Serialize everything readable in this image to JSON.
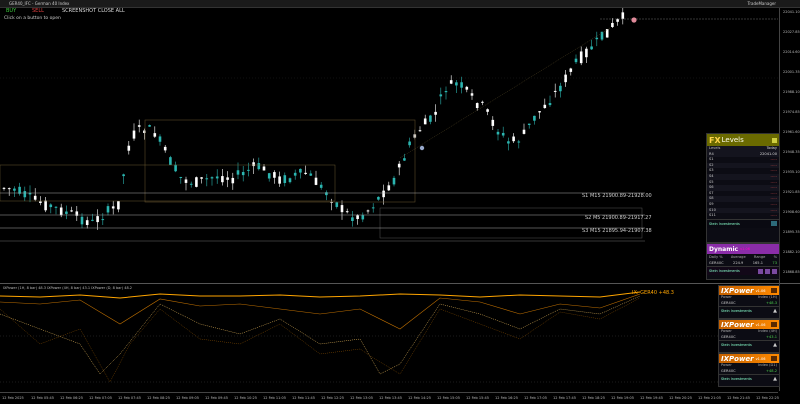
{
  "window": {
    "title": "GER40_IFC - German 40 Index",
    "right_label": "TradeManager"
  },
  "toolbar": {
    "buy_label": "BUY",
    "sell_label": "SELL",
    "screenshot_label": "SCREENSHOT CLOSE ALL",
    "hint": "Click on a button to open"
  },
  "price_axis": {
    "labels": [
      "22041.10",
      "22027.85",
      "22014.60",
      "22001.35",
      "21988.10",
      "21974.85",
      "21961.60",
      "21948.35",
      "21935.10",
      "21921.85",
      "21908.60",
      "21895.35",
      "21882.10",
      "21868.85"
    ]
  },
  "levels": [
    {
      "label": "S1 M15 21900.89-21928.00"
    },
    {
      "label": "S2 M5 21900.89-21917.27"
    },
    {
      "label": "S3 M15 21895.94-21907.38"
    }
  ],
  "indicator": {
    "title": "IXPower (1H, 8 bar) 48.3  IXPower (4H, 8 bar) 43.1  IXPower (D, 8 bar) 48.2",
    "value_label": "IX: GER40 +48.3"
  },
  "time_axis": {
    "labels": [
      "12 Feb 2025",
      "12 Feb 05:45",
      "12 Feb 06:25",
      "12 Feb 07:05",
      "12 Feb 07:45",
      "12 Feb 08:25",
      "12 Feb 09:05",
      "12 Feb 09:45",
      "12 Feb 10:25",
      "12 Feb 11:05",
      "12 Feb 11:45",
      "12 Feb 12:25",
      "12 Feb 13:05",
      "12 Feb 13:45",
      "12 Feb 14:25",
      "12 Feb 15:05",
      "12 Feb 15:45",
      "12 Feb 16:25",
      "12 Feb 17:05",
      "12 Feb 17:45",
      "12 Feb 18:25",
      "12 Feb 19:05",
      "12 Feb 19:45",
      "12 Feb 20:25",
      "12 Feb 21:05",
      "12 Feb 21:45",
      "12 Feb 22:25"
    ]
  },
  "fx_levels": {
    "logo_a": "FX",
    "logo_b": "Levels",
    "col_level": "Levels",
    "col_value": "Today",
    "rows": [
      {
        "name": "R4",
        "value": "22041.00"
      },
      {
        "name": "S1",
        "value": "-----"
      },
      {
        "name": "S2",
        "value": "-----"
      },
      {
        "name": "S3",
        "value": "-----"
      },
      {
        "name": "S4",
        "value": "-----"
      },
      {
        "name": "S5",
        "value": "-----"
      },
      {
        "name": "S6",
        "value": "-----"
      },
      {
        "name": "S7",
        "value": "-----"
      },
      {
        "name": "S8",
        "value": "-----"
      },
      {
        "name": "S9",
        "value": "-----"
      },
      {
        "name": "S10",
        "value": "-----"
      },
      {
        "name": "S11",
        "value": "-----"
      }
    ],
    "foot": "Stein Investments"
  },
  "dynamic": {
    "title": "Dynamic",
    "sub": "v1.06",
    "h_daily": "Daily %",
    "h_average": "Average",
    "h_range": "Range",
    "h_pct": "%",
    "symbol": "GER40C",
    "average": "224.9",
    "range": "165.1",
    "pct": "73",
    "foot": "Stein Investments"
  },
  "ix_power": [
    {
      "title": "IXPower",
      "sub": "v1.06",
      "h_pair": "Power",
      "h_index": "Index (1H)",
      "symbol": "GER40C",
      "value": "+48.3",
      "foot": "Stein Investments"
    },
    {
      "title": "IXPower",
      "sub": "v1.06",
      "h_pair": "Power",
      "h_index": "Index (4H)",
      "symbol": "GER40C",
      "value": "+43.1",
      "foot": "Stein Investments"
    },
    {
      "title": "IXPower",
      "sub": "v1.06",
      "h_pair": "Power",
      "h_index": "Index (D1)",
      "symbol": "GER40C",
      "value": "+48.2",
      "foot": "Stein Investments"
    }
  ],
  "colors": {
    "bull": "#2bb5b0",
    "bear": "#ffffff",
    "ix": "#ffa500",
    "panel_fx": "#6a6a00",
    "panel_dyn": "#8a2da8"
  }
}
